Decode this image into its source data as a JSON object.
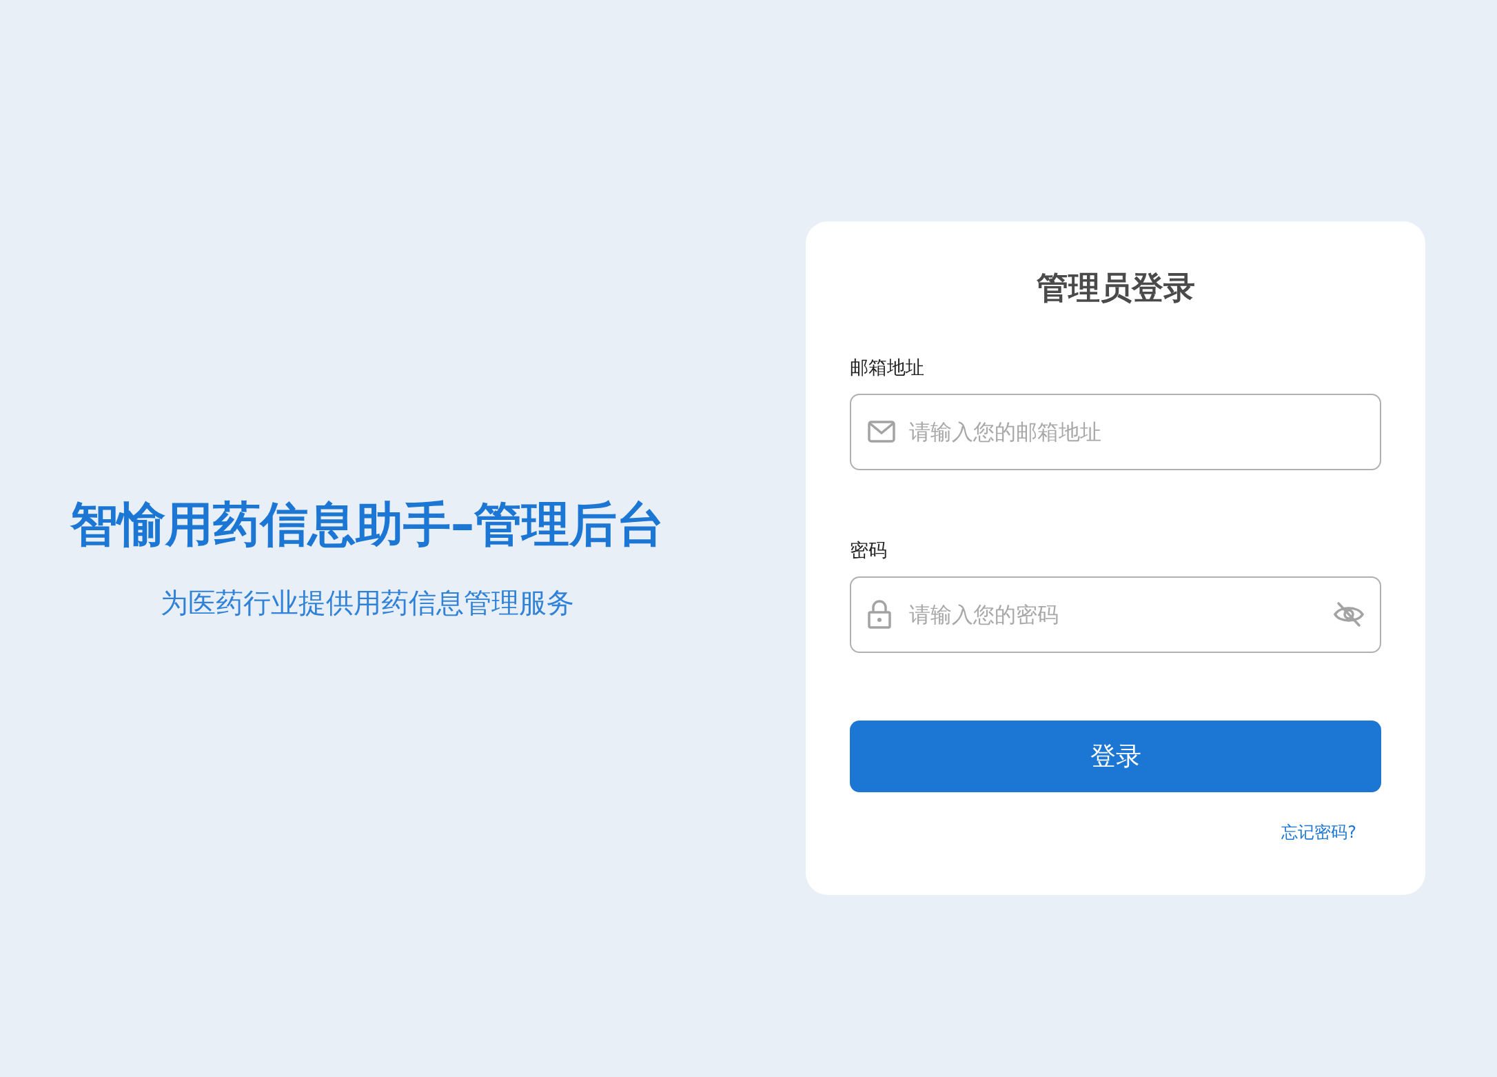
{
  "brand": {
    "title": "智愉用药信息助手–管理后台",
    "subtitle": "为医药行业提供用药信息管理服务"
  },
  "login": {
    "title": "管理员登录",
    "fields": [
      {
        "kind": "email",
        "label": "邮箱地址",
        "placeholder": "请输入您的邮箱地址"
      },
      {
        "kind": "password",
        "label": "密码",
        "placeholder": "请输入您的密码"
      }
    ],
    "button": "登录",
    "forgot_link": "忘记密码?"
  }
}
